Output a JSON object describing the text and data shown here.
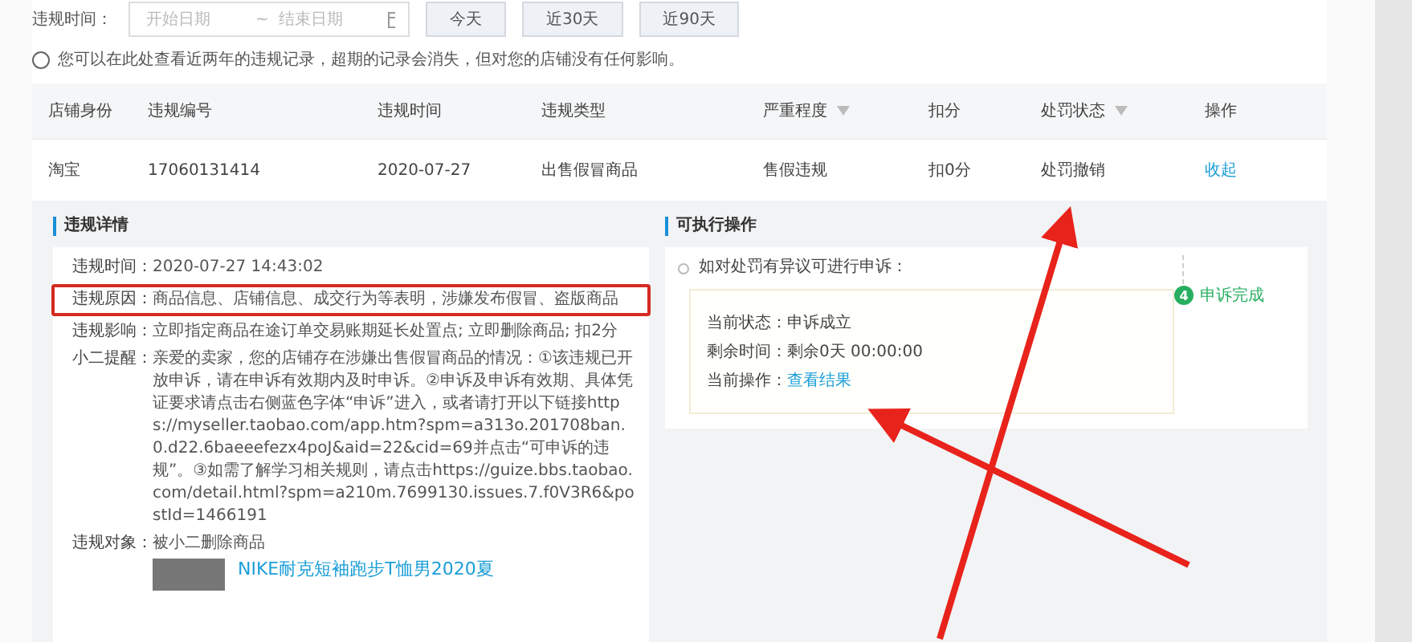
{
  "filter": {
    "label": "违规时间：",
    "start_placeholder": "开始日期",
    "separator": "~",
    "end_placeholder": "结束日期",
    "quick_buttons": [
      "今天",
      "近30天",
      "近90天"
    ]
  },
  "notice": "您可以在此处查看近两年的违规记录，超期的记录会消失，但对您的店铺没有任何影响。",
  "table": {
    "columns": [
      {
        "label": "店铺身份",
        "filter": false
      },
      {
        "label": "违规编号",
        "filter": false
      },
      {
        "label": "违规时间",
        "filter": false
      },
      {
        "label": "违规类型",
        "filter": false
      },
      {
        "label": "严重程度",
        "filter": true
      },
      {
        "label": "扣分",
        "filter": false
      },
      {
        "label": "处罚状态",
        "filter": true
      },
      {
        "label": "操作",
        "filter": false
      }
    ],
    "rows": [
      {
        "cells": [
          "淘宝",
          "17060131414",
          "2020-07-27",
          "出售假冒商品",
          "售假违规",
          "扣0分",
          "处罚撤销"
        ],
        "action": "收起"
      }
    ]
  },
  "details": {
    "title": "违规详情",
    "fields": [
      {
        "label": "违规时间：",
        "value": "2020-07-27 14:43:02",
        "highlighted": false
      },
      {
        "label": "违规原因：",
        "value": "商品信息、店铺信息、成交行为等表明，涉嫌发布假冒、盗版商品",
        "highlighted": true
      },
      {
        "label": "违规影响：",
        "value": "立即指定商品在途订单交易账期延长处置点; 立即删除商品; 扣2分",
        "highlighted": false
      },
      {
        "label": "小二提醒：",
        "value": "亲爱的卖家，您的店铺存在涉嫌出售假冒商品的情况：①该违规已开放申诉，请在申诉有效期内及时申诉。②申诉及申诉有效期、具体凭证要求请点击右侧蓝色字体“申诉”进入，或者请打开以下链接https://myseller.taobao.com/app.htm?spm=a313o.201708ban.0.d22.6baeeefezx4poJ&aid=22&cid=69并点击“可申诉的违规”。③如需了解学习相关规则，请点击https://guize.bbs.taobao.com/detail.html?spm=a210m.7699130.issues.7.f0V3R6&postId=1466191",
        "highlighted": false
      },
      {
        "label": "违规对象：",
        "value": "被小二删除商品",
        "highlighted": false,
        "product": {
          "title": "NIKE耐克短袖跑步T恤男2020夏"
        }
      }
    ]
  },
  "actions": {
    "title": "可执行操作",
    "prompt": "如对处罚有异议可进行申诉：",
    "lines": [
      {
        "label": "当前状态：",
        "value": "申诉成立"
      },
      {
        "label": "剩余时间：",
        "value": "剩余0天 00:00:00"
      },
      {
        "label": "当前操作：",
        "link": "查看结果"
      }
    ],
    "step": {
      "number": "4",
      "label": "申诉完成"
    }
  }
}
